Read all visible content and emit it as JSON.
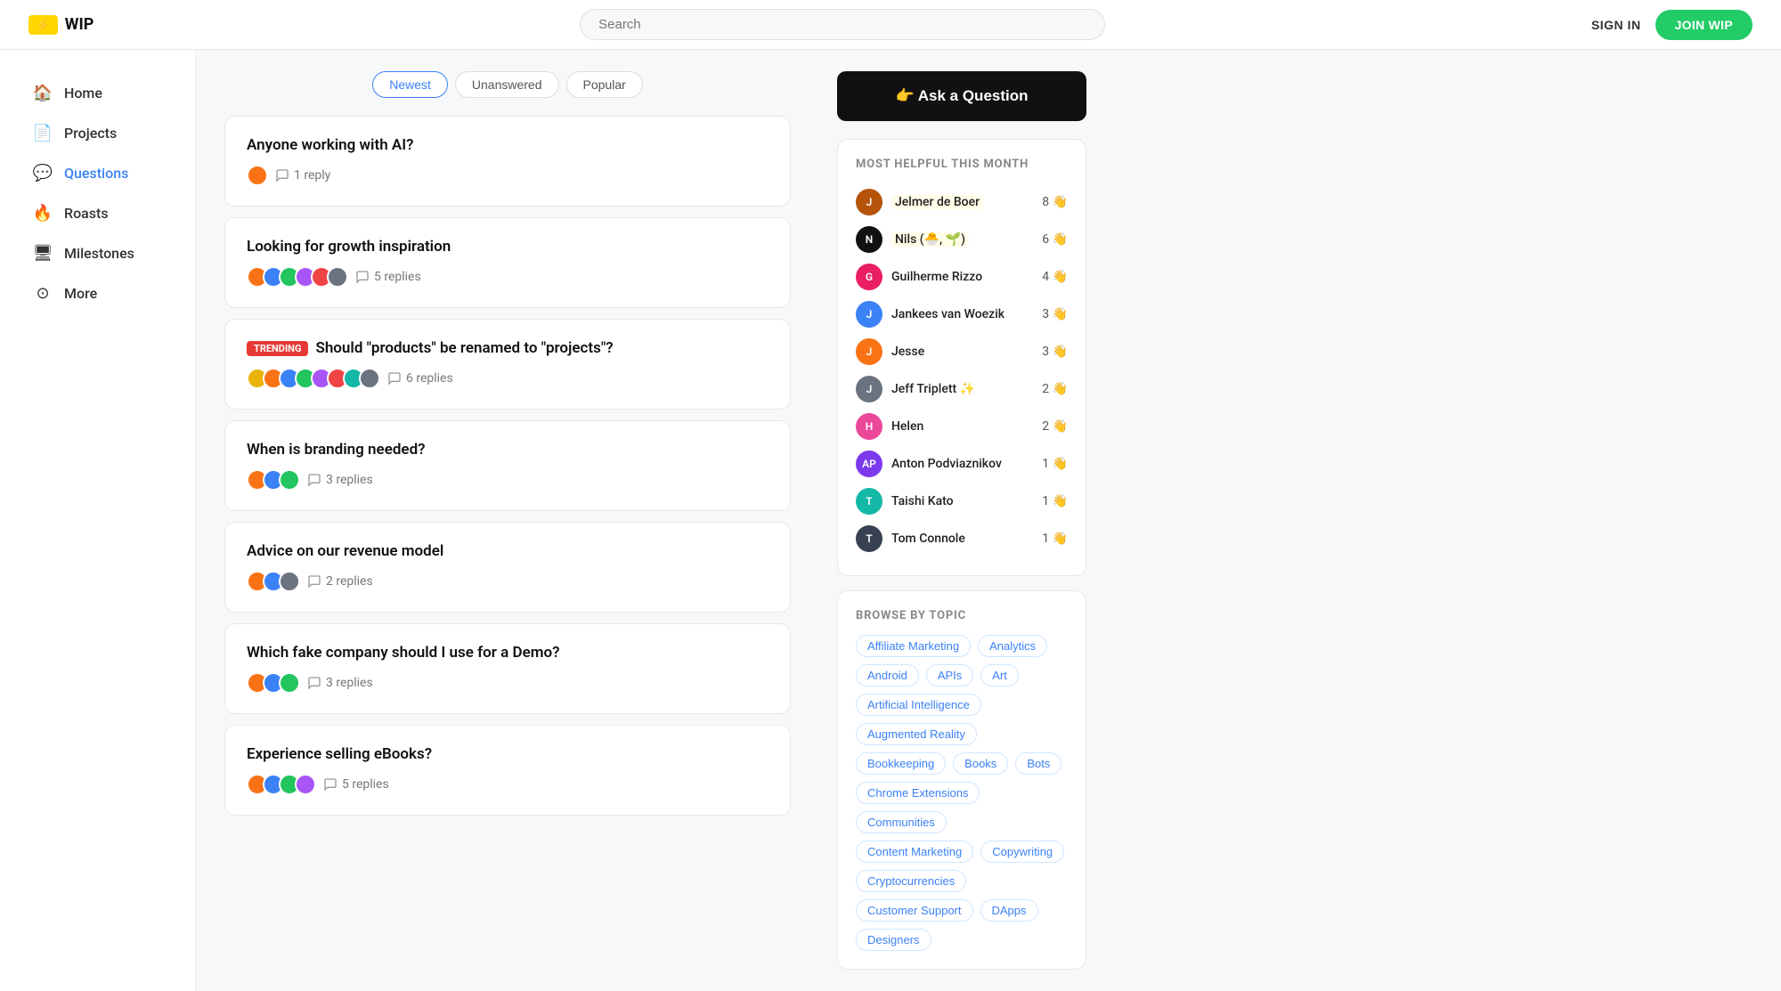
{
  "header": {
    "logo_text": "WIP",
    "logo_badge": "⚡",
    "search_placeholder": "Search",
    "sign_in_label": "SIGN IN",
    "join_label": "JOIN WIP"
  },
  "sidebar": {
    "items": [
      {
        "id": "home",
        "label": "Home",
        "icon": "🏠"
      },
      {
        "id": "projects",
        "label": "Projects",
        "icon": "📄"
      },
      {
        "id": "questions",
        "label": "Questions",
        "icon": "💬",
        "active": true
      },
      {
        "id": "roasts",
        "label": "Roasts",
        "icon": "🔥"
      },
      {
        "id": "milestones",
        "label": "Milestones",
        "icon": "🖥"
      },
      {
        "id": "more",
        "label": "More",
        "icon": "⊙"
      }
    ]
  },
  "main": {
    "filters": [
      {
        "id": "newest",
        "label": "Newest",
        "active": true
      },
      {
        "id": "unanswered",
        "label": "Unanswered",
        "active": false
      },
      {
        "id": "popular",
        "label": "Popular",
        "active": false
      }
    ],
    "questions": [
      {
        "id": "q1",
        "title": "Anyone working with AI?",
        "trending": false,
        "replies": "1 reply",
        "avatars": [
          "orange"
        ]
      },
      {
        "id": "q2",
        "title": "Looking for growth inspiration",
        "trending": false,
        "replies": "5 replies",
        "avatars": [
          "orange",
          "blue",
          "green",
          "purple",
          "red",
          "gray"
        ]
      },
      {
        "id": "q3",
        "title": "Should \"products\" be renamed to \"projects\"?",
        "trending": true,
        "replies": "6 replies",
        "avatars": [
          "yellow",
          "orange",
          "blue",
          "green",
          "purple",
          "red",
          "teal",
          "gray"
        ]
      },
      {
        "id": "q4",
        "title": "When is branding needed?",
        "trending": false,
        "replies": "3 replies",
        "avatars": [
          "orange",
          "blue",
          "green"
        ]
      },
      {
        "id": "q5",
        "title": "Advice on our revenue model",
        "trending": false,
        "replies": "2 replies",
        "avatars": [
          "orange",
          "blue",
          "gray"
        ]
      },
      {
        "id": "q6",
        "title": "Which fake company should I use for a Demo?",
        "trending": false,
        "replies": "3 replies",
        "avatars": [
          "orange",
          "blue",
          "green"
        ]
      },
      {
        "id": "q7",
        "title": "Experience selling eBooks?",
        "trending": false,
        "replies": "5 replies",
        "avatars": [
          "orange",
          "blue",
          "green",
          "purple"
        ]
      }
    ]
  },
  "right_sidebar": {
    "ask_button_label": "👉 Ask a Question",
    "most_helpful_title": "MOST HELPFUL THIS MONTH",
    "helpers": [
      {
        "name": "Jelmer de Boer",
        "score": 8,
        "highlight": true,
        "color": "#b45309"
      },
      {
        "name": "Nils (🐣, 🌱)",
        "score": 6,
        "highlight": true,
        "color": "#111"
      },
      {
        "name": "Guilherme Rizzo",
        "score": 4,
        "highlight": false,
        "color": "#e91e63"
      },
      {
        "name": "Jankees van Woezik",
        "score": 3,
        "highlight": false,
        "color": "#3b82f6"
      },
      {
        "name": "Jesse",
        "score": 3,
        "highlight": false,
        "color": "#f97316"
      },
      {
        "name": "Jeff Triplett ✨",
        "score": 2,
        "highlight": false,
        "color": "#6b7280"
      },
      {
        "name": "Helen",
        "score": 2,
        "highlight": false,
        "color": "#ec4899"
      },
      {
        "name": "Anton Podviaznikov",
        "score": 1,
        "highlight": false,
        "color": "#7c3aed",
        "initials": "AP"
      },
      {
        "name": "Taishi Kato",
        "score": 1,
        "highlight": false,
        "color": "#14b8a6"
      },
      {
        "name": "Tom Connole",
        "score": 1,
        "highlight": false,
        "color": "#374151"
      }
    ],
    "browse_title": "BROWSE BY TOPIC",
    "topics": [
      "Affiliate Marketing",
      "Analytics",
      "Android",
      "APIs",
      "Art",
      "Artificial Intelligence",
      "Augmented Reality",
      "Bookkeeping",
      "Books",
      "Bots",
      "Chrome Extensions",
      "Communities",
      "Content Marketing",
      "Copywriting",
      "Cryptocurrencies",
      "Customer Support",
      "DApps",
      "Designers"
    ]
  }
}
